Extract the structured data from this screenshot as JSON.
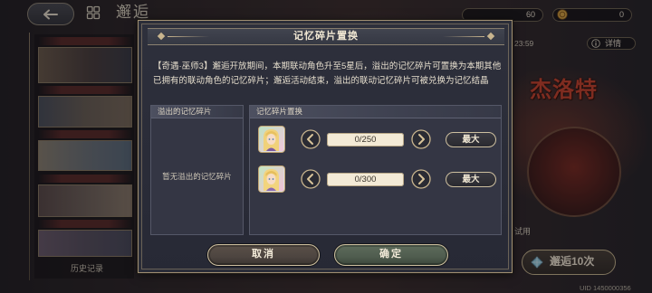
{
  "background": {
    "page_title": "邂逅",
    "resource_counts": [
      "60",
      "0"
    ],
    "countdown": "23:59",
    "details_label": "详情",
    "featured_name": "杰洛特",
    "trial_label": "试用",
    "summon_ten_label": "邂逅10次",
    "history_label": "历史记录",
    "uid": "UID 1450000356"
  },
  "dialog": {
    "title": "记忆碎片置换",
    "description": [
      "【奇遇·巫师3】邂逅开放期间，本期联动角色升至5星后，溢出的记忆碎片可置换为本期其他",
      "已拥有的联动角色的记忆碎片；邂逅活动结束，溢出的联动记忆碎片可被兑换为记忆结晶"
    ],
    "overflow_panel": {
      "header": "溢出的记忆碎片",
      "empty_text": "暂无溢出的记忆碎片"
    },
    "exchange_panel": {
      "header": "记忆碎片置换",
      "rows": [
        {
          "value": "0/250",
          "max_label": "最大"
        },
        {
          "value": "0/300",
          "max_label": "最大"
        }
      ]
    },
    "cancel_label": "取消",
    "confirm_label": "确定"
  },
  "icons": {
    "back": "back-arrow-icon",
    "home": "home-icon",
    "coin": "coin-icon",
    "info": "info-icon",
    "decrease": "chevron-left-icon",
    "increase": "chevron-right-icon",
    "summon": "gem-icon",
    "ornament": "diamond-ornament-icon"
  },
  "colors": {
    "dialog_background": "#2e303c",
    "frame_border": "#a08f72",
    "text_light": "#efe6d2",
    "value_field": "#f3ead6",
    "accent_gold": "#c9b58e",
    "featured_name": "#c8432c",
    "cancel_fill": "#4d4540",
    "confirm_fill": "#4f5c4e"
  }
}
